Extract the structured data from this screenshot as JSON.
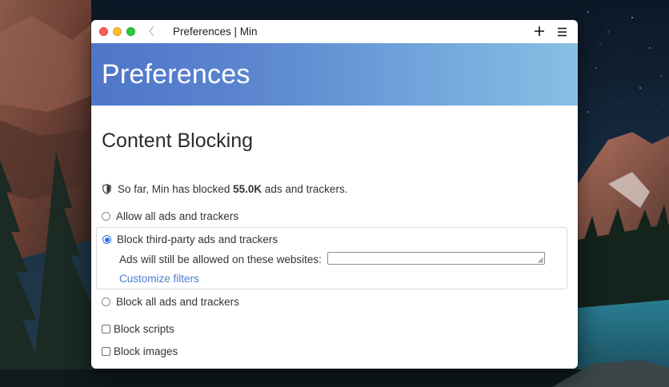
{
  "window": {
    "tab_title": "Preferences | Min"
  },
  "banner": {
    "title": "Preferences"
  },
  "content_blocking": {
    "heading": "Content Blocking",
    "stats_prefix": "So far, Min has blocked",
    "stats_count": "55.0K",
    "stats_suffix": "ads and trackers.",
    "options": [
      {
        "label": "Allow all ads and trackers",
        "selected": false
      },
      {
        "label": "Block third-party ads and trackers",
        "selected": true
      },
      {
        "label": "Block all ads and trackers",
        "selected": false
      }
    ],
    "allowed_sites_label": "Ads will still be allowed on these websites:",
    "allowed_sites_value": "",
    "customize_link": "Customize filters",
    "checkboxes": [
      {
        "label": "Block scripts",
        "checked": false
      },
      {
        "label": "Block images",
        "checked": false
      }
    ]
  },
  "icons": {
    "back": "chevron-left-icon",
    "new_tab": "plus-icon",
    "menu": "hamburger-menu-icon",
    "stats": "shield-icon"
  },
  "colors": {
    "accent": "#2e6fe0",
    "link": "#4a7fd1",
    "banner_start": "#4f76c9",
    "banner_end": "#86c0e3"
  }
}
